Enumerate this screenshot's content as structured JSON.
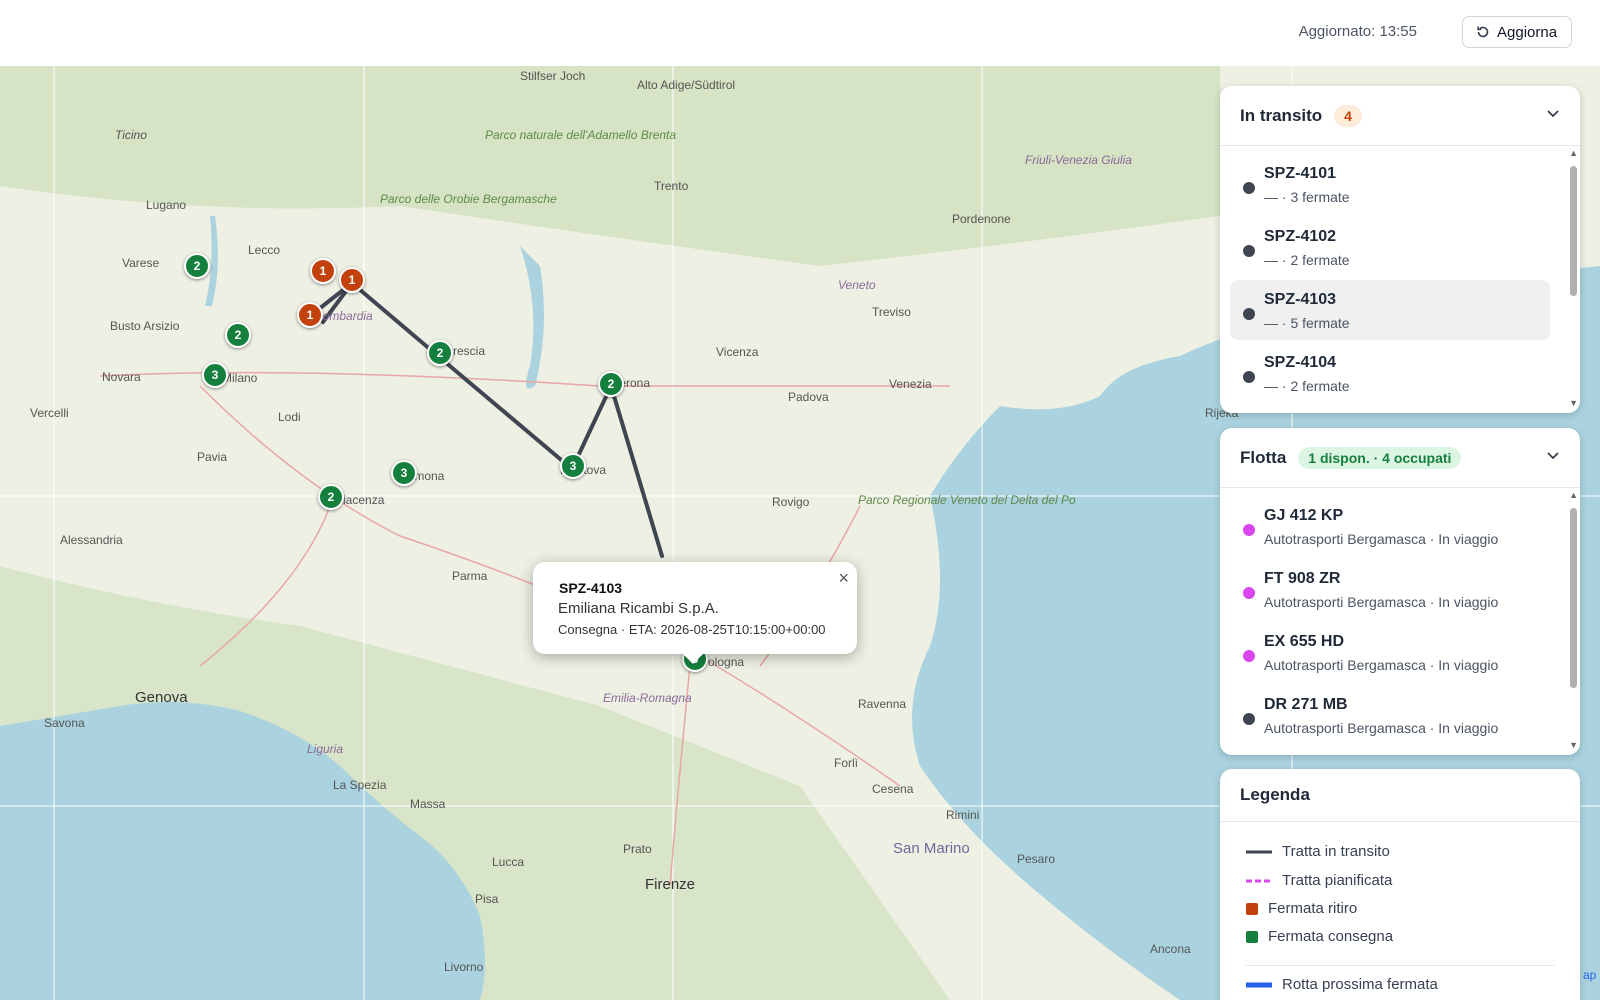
{
  "header": {
    "updated_text": "Aggiornato: 13:55",
    "refresh_label": "Aggiorna"
  },
  "colors": {
    "pickup": "#c2410c",
    "delivery": "#15803d",
    "route_transit": "#3f4652",
    "route_planned": "#d946ef",
    "next_stop_route": "#2563eb",
    "sea": "#aad3df",
    "land": "#eef0e4"
  },
  "map": {
    "places": [
      "Stilfser Joch",
      "Trento",
      "Alto Adige/Südtirol",
      "Parco naturale dell'Adamello Brenta",
      "Parco delle Orobie Bergamasche",
      "Friuli-Venezia Giulia",
      "Lugano",
      "Ticino",
      "Varese",
      "Lecco",
      "Busto Arsizio",
      "Novara",
      "Vercelli",
      "Lodi",
      "Pavia",
      "Alessandria",
      "Parma",
      "Genova",
      "Savona",
      "Liguria",
      "La Spezia",
      "Massa",
      "Lucca",
      "Pisa",
      "Livorno",
      "Prato",
      "Firenze",
      "Emilia-Romagna",
      "Ravenna",
      "Forlì",
      "Cesena",
      "Rimini",
      "San Marino",
      "Pesaro",
      "Ancona",
      "Rovigo",
      "Padova",
      "Vicenza",
      "Treviso",
      "Venezia",
      "Veneto",
      "Pordenone",
      "Parco Regionale Veneto del Delta del Po",
      "Rijeka",
      "Lombardia",
      "Milano",
      "Brescia",
      "Verona",
      "Mantova",
      "Cremona",
      "Piacenza",
      "Bologna"
    ],
    "markers": [
      {
        "label": "1",
        "kind": "pickup"
      },
      {
        "label": "1",
        "kind": "pickup"
      },
      {
        "label": "1",
        "kind": "pickup"
      },
      {
        "label": "2",
        "kind": "delivery"
      },
      {
        "label": "2",
        "kind": "delivery"
      },
      {
        "label": "3",
        "kind": "delivery"
      },
      {
        "label": "2",
        "kind": "delivery"
      },
      {
        "label": "2",
        "kind": "delivery"
      },
      {
        "label": "3",
        "kind": "delivery"
      },
      {
        "label": "3",
        "kind": "delivery"
      },
      {
        "label": "2",
        "kind": "delivery"
      },
      {
        "label": "5",
        "kind": "delivery"
      }
    ],
    "popup": {
      "title": "SPZ-4103",
      "company": "Emiliana Ricambi S.p.A.",
      "line": "Consegna · ETA: 2026-08-25T10:15:00+00:00",
      "close": "×"
    }
  },
  "transit": {
    "title": "In transito",
    "count": "4",
    "items": [
      {
        "title": "SPZ-4101",
        "subtitle": "— · 3 fermate",
        "color": "#3f4652"
      },
      {
        "title": "SPZ-4102",
        "subtitle": "— · 2 fermate",
        "color": "#3f4652"
      },
      {
        "title": "SPZ-4103",
        "subtitle": "— · 5 fermate",
        "color": "#3f4652",
        "selected": true
      },
      {
        "title": "SPZ-4104",
        "subtitle": "— · 2 fermate",
        "color": "#3f4652"
      }
    ]
  },
  "fleet": {
    "title": "Flotta",
    "status": "1 dispon. · 4 occupati",
    "items": [
      {
        "title": "GJ 412 KP",
        "subtitle": "Autotrasporti Bergamasca · In viaggio",
        "color": "#d946ef"
      },
      {
        "title": "FT 908 ZR",
        "subtitle": "Autotrasporti Bergamasca · In viaggio",
        "color": "#d946ef"
      },
      {
        "title": "EX 655 HD",
        "subtitle": "Autotrasporti Bergamasca · In viaggio",
        "color": "#d946ef"
      },
      {
        "title": "DR 271 MB",
        "subtitle": "Autotrasporti Bergamasca · In viaggio",
        "color": "#3f4652"
      }
    ]
  },
  "legend": {
    "title": "Legenda",
    "items": [
      {
        "label": "Tratta in transito",
        "symbol": "solid-line"
      },
      {
        "label": "Tratta pianificata",
        "symbol": "dashed-line"
      },
      {
        "label": "Fermata ritiro",
        "symbol": "square-pickup"
      },
      {
        "label": "Fermata consegna",
        "symbol": "square-delivery"
      },
      {
        "label": "Rotta prossima fermata",
        "symbol": "thick-line"
      }
    ]
  },
  "attribution": "ap"
}
